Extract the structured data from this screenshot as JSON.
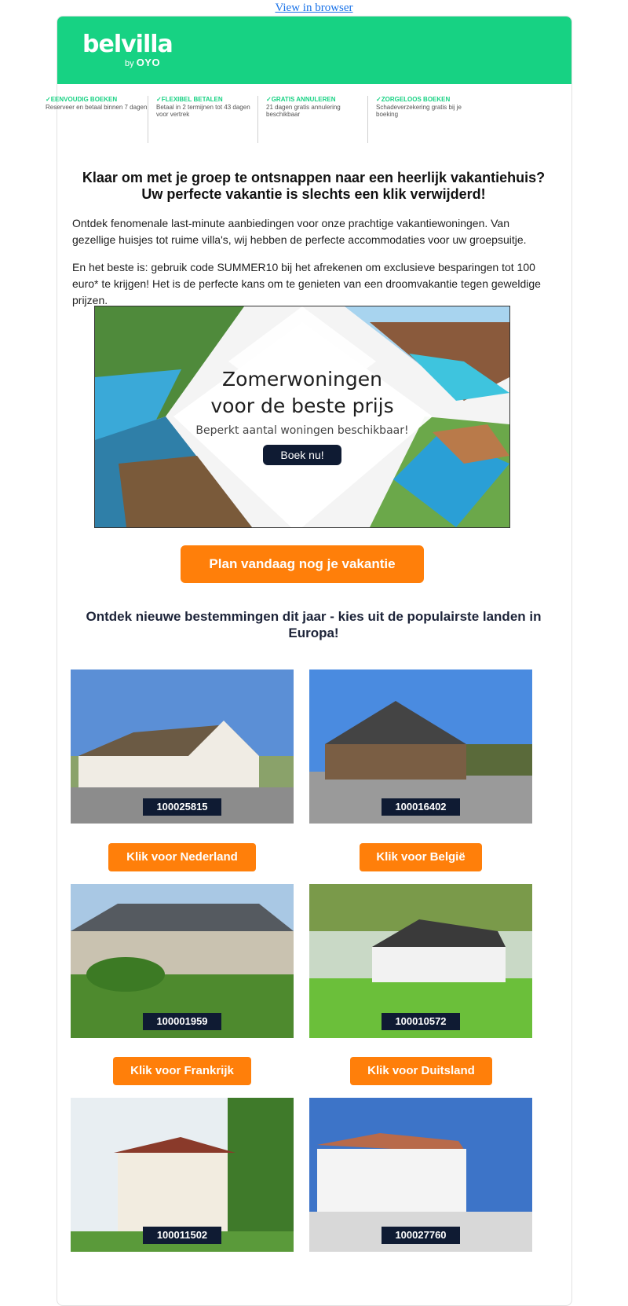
{
  "top": {
    "view_in_browser": "View in browser"
  },
  "logo": {
    "name": "belvilla",
    "by": "by",
    "brand": "OYO"
  },
  "usps": [
    {
      "title": "EENVOUDIG BOEKEN",
      "desc": "Reserveer en betaal binnen 7 dagen"
    },
    {
      "title": "FLEXIBEL BETALEN",
      "desc": "Betaal in 2 termijnen tot 43 dagen voor vertrek"
    },
    {
      "title": "GRATIS ANNULEREN",
      "desc": "21 dagen gratis annulering beschikbaar"
    },
    {
      "title": "ZORGELOOS BOEKEN",
      "desc": "Schadeverzekering gratis bij je boeking"
    }
  ],
  "intro": {
    "title": "Klaar om met je groep te ontsnappen naar een heerlijk vakantiehuis? Uw perfecte vakantie is slechts een klik verwijderd!",
    "p1": "Ontdek fenomenale last-minute aanbiedingen voor onze prachtige vakantiewoningen. Van gezellige huisjes tot ruime villa's, wij hebben de perfecte accommodaties voor uw groepsuitje.",
    "p2": "En het beste is: gebruik code SUMMER10 bij het afrekenen om exclusieve besparingen tot 100 euro* te krijgen! Het is de perfecte kans om te genieten van een droomvakantie tegen geweldige prijzen."
  },
  "banner": {
    "line1": "Zomerwoningen",
    "line2": "voor de beste prijs",
    "sub": "Beperkt aantal woningen beschikbaar!",
    "button": "Boek nu!"
  },
  "cta": "Plan vandaag nog je vakantie",
  "destinations_title": "Ontdek nieuwe bestemmingen dit jaar - kies uit de populairste landen in Europa!",
  "properties": [
    {
      "id": "100025815",
      "button": "Klik voor Nederland"
    },
    {
      "id": "100016402",
      "button": "Klik voor België"
    },
    {
      "id": "100001959",
      "button": "Klik voor Frankrijk"
    },
    {
      "id": "100010572",
      "button": "Klik voor Duitsland"
    },
    {
      "id": "100011502"
    },
    {
      "id": "100027760"
    }
  ],
  "colors": {
    "brand_green": "#17d283",
    "cta_orange": "#ff7f0a",
    "navy": "#0f1b33"
  }
}
